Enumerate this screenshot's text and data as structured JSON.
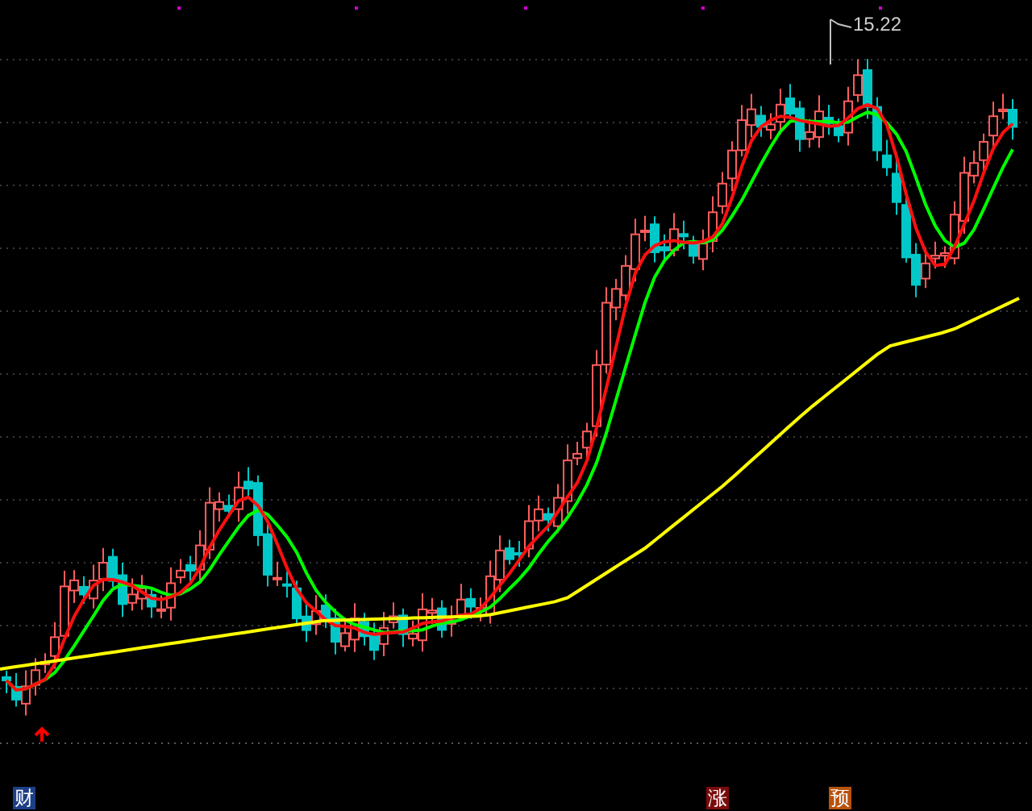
{
  "chart": {
    "high_label": "15.22"
  },
  "badges": [
    {
      "label": "财",
      "color": "#1d3f86"
    },
    {
      "label": "涨",
      "color": "#7a0c0c"
    },
    {
      "label": "预",
      "color": "#b8520c"
    }
  ]
}
